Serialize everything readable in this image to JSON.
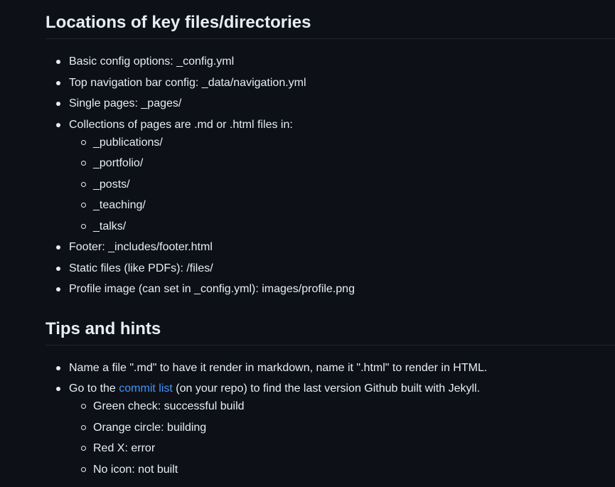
{
  "section1": {
    "heading": "Locations of key files/directories",
    "items": [
      "Basic config options: _config.yml",
      "Top navigation bar config: _data/navigation.yml",
      "Single pages: _pages/",
      "Collections of pages are .md or .html files in:"
    ],
    "collections": [
      "_publications/",
      "_portfolio/",
      "_posts/",
      "_teaching/",
      "_talks/"
    ],
    "items_after": [
      "Footer: _includes/footer.html",
      "Static files (like PDFs): /files/",
      "Profile image (can set in _config.yml): images/profile.png"
    ]
  },
  "section2": {
    "heading": "Tips and hints",
    "tip1": "Name a file \".md\" to have it render in markdown, name it \".html\" to render in HTML.",
    "tip2_before": "Go to the ",
    "tip2_link": "commit list",
    "tip2_after": " (on your repo) to find the last version Github built with Jekyll.",
    "statuses": [
      "Green check: successful build",
      "Orange circle: building",
      "Red X: error",
      "No icon: not built"
    ]
  },
  "colors": {
    "background": "#0d1117",
    "text": "#e6edf3",
    "link": "#4493f8",
    "divider": "#21262d"
  }
}
